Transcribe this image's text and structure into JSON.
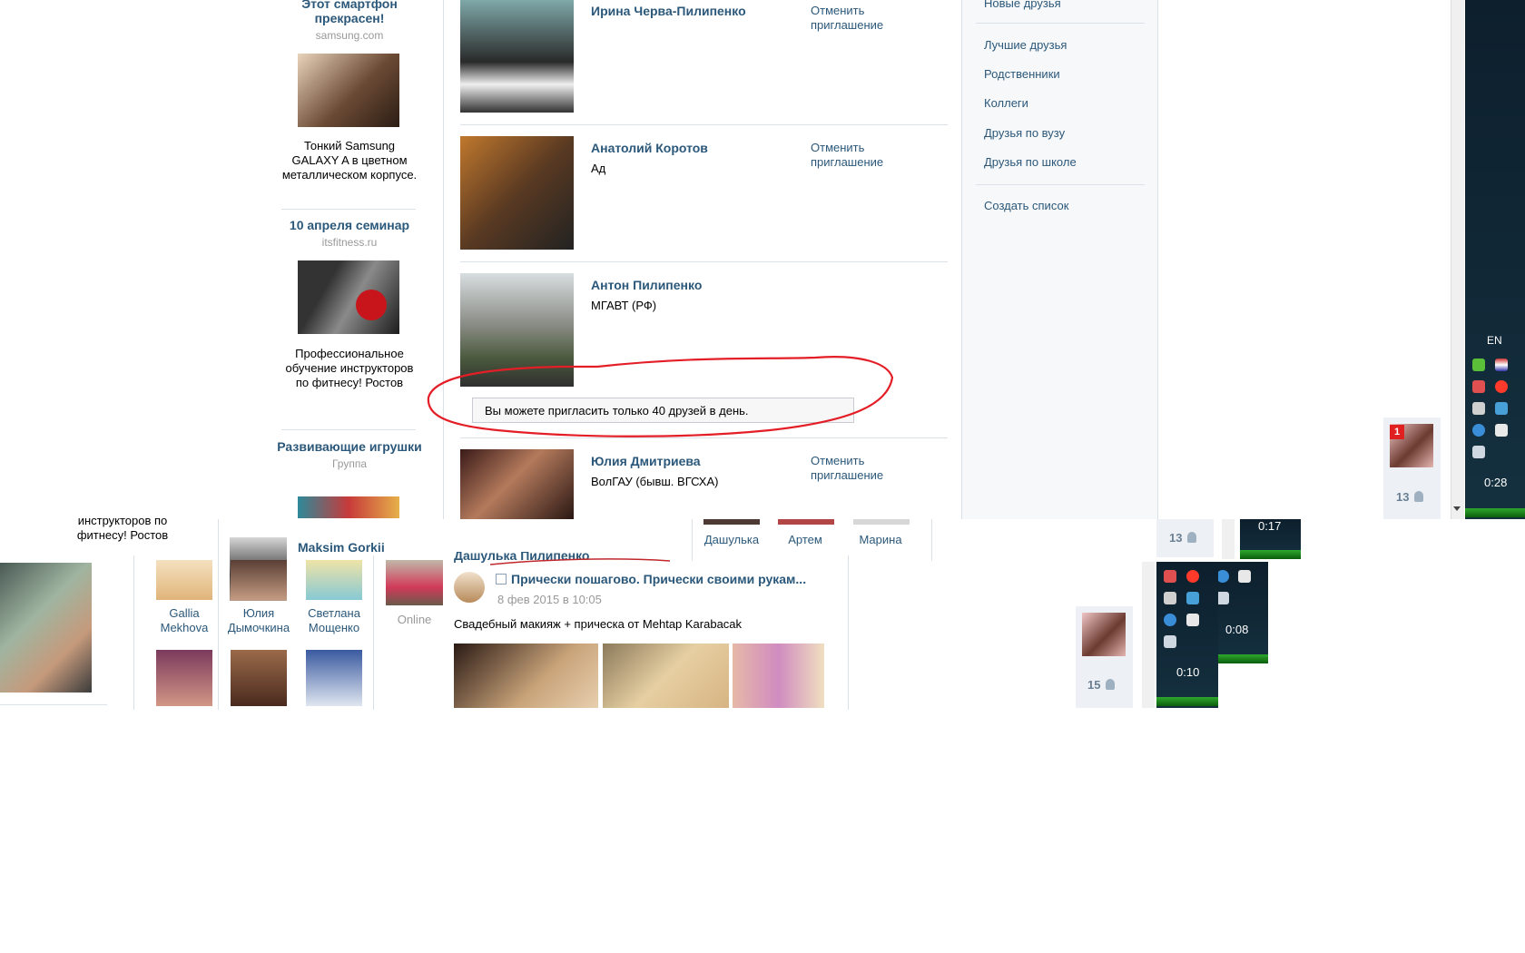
{
  "ads": [
    {
      "title": "Этот смартфон прекрасен!",
      "source": "samsung.com",
      "text": "Тонкий Samsung GALAXY A в цветном металлическом корпусе."
    },
    {
      "title": "10 апреля семинар",
      "source": "itsfitness.ru",
      "text": "Профессиональное обучение инструкторов по фитнесу! Ростов"
    },
    {
      "title": "Развивающие игрушки",
      "source": "Группа"
    }
  ],
  "requests": [
    {
      "name": "Ирина Черва-Пилипенко",
      "subtitle": "",
      "action": "Отменить приглашение"
    },
    {
      "name": "Анатолий Коротов",
      "subtitle": "Ад",
      "action": "Отменить приглашение"
    },
    {
      "name": "Антон Пилипенко",
      "subtitle": "МГАВТ (РФ)",
      "action": ""
    },
    {
      "name": "Юлия Дмитриева",
      "subtitle": "ВолГАУ (бывш. ВГСХА)",
      "action": "Отменить приглашение"
    }
  ],
  "limit_message": "Вы можете пригласить только 40 друзей в день.",
  "sidebar_menu": {
    "top_item": "Новые друзья",
    "items": [
      "Лучшие друзья",
      "Родственники",
      "Коллеги",
      "Друзья по вузу",
      "Друзья по школе"
    ],
    "create_list": "Создать список"
  },
  "tray": {
    "lang": "EN",
    "clock_main": "0:28",
    "clock_2": "0:17",
    "clock_3": "0:08",
    "clock_4": "0:10"
  },
  "chat": {
    "badge": "1",
    "count_1": "13",
    "count_2": "13",
    "count_3": "15"
  },
  "bottom": {
    "ad_tail": "инструкторов по фитнесу! Ростов",
    "user_name": "Maksim Gorkii",
    "friend_labels": [
      "Дашулька",
      "Артем",
      "Марина"
    ],
    "friends": [
      {
        "first": "Gallia",
        "last": "Mekhova"
      },
      {
        "first": "Юлия",
        "last": "Дымочкина"
      },
      {
        "first": "Светлана",
        "last": "Мощенко"
      }
    ],
    "online": "Online",
    "post_author_cut": "Дашулька Пилипенко",
    "post_group": "Прически пошагово. Прически своими рукам...",
    "post_date": "8 фев 2015 в 10:05",
    "post_text": "Свадебный макияж + прическа от Mehtap Karabacak"
  }
}
